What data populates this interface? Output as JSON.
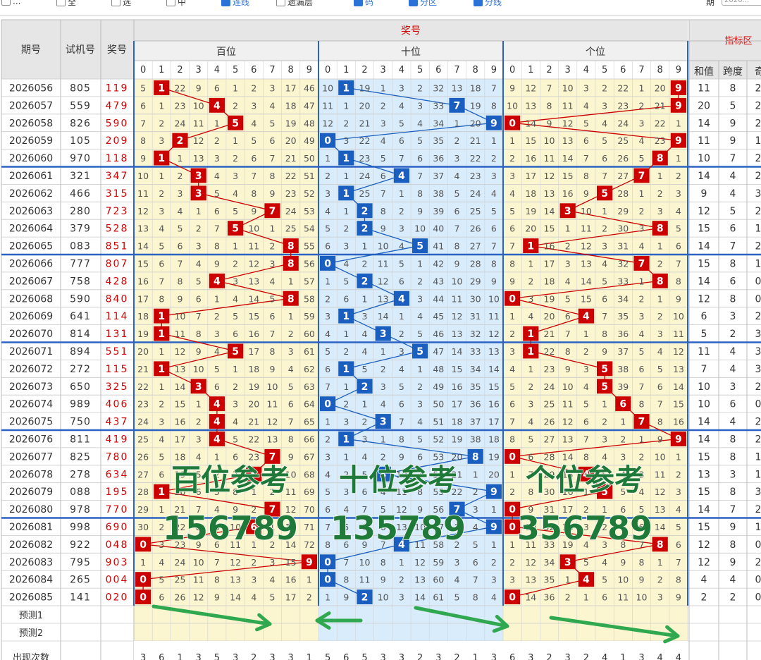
{
  "toolbar": {
    "options": [
      {
        "label": "...",
        "checked": false,
        "blue": false
      },
      {
        "label": "全",
        "checked": false,
        "blue": false
      },
      {
        "label": "选",
        "checked": false,
        "blue": false
      },
      {
        "label": "中",
        "checked": false,
        "blue": false
      },
      {
        "label": "连线",
        "checked": true,
        "blue": true
      },
      {
        "label": "遗漏层",
        "checked": false,
        "blue": false
      },
      {
        "label": "码",
        "checked": true,
        "blue": true
      },
      {
        "label": "分区",
        "checked": true,
        "blue": true
      },
      {
        "label": "分线",
        "checked": true,
        "blue": true
      }
    ],
    "period_label": "期",
    "period_value": "2026..."
  },
  "header": {
    "period": "期号",
    "trial": "试机号",
    "prize": "奖号",
    "prize_group": "奖号",
    "index_area": "指标区",
    "positions": [
      "百位",
      "十位",
      "个位"
    ],
    "digits": [
      "0",
      "1",
      "2",
      "3",
      "4",
      "5",
      "6",
      "7",
      "8",
      "9"
    ],
    "indicators": [
      "和值",
      "跨度",
      "奇"
    ]
  },
  "rows": [
    {
      "period": "2026056",
      "trial": "805",
      "prize": "119",
      "hu": [
        5,
        1,
        22,
        9,
        6,
        1,
        2,
        3,
        17,
        46
      ],
      "te": [
        10,
        1,
        19,
        1,
        3,
        2,
        32,
        13,
        18,
        7
      ],
      "ge": [
        9,
        12,
        7,
        10,
        3,
        2,
        22,
        1,
        20,
        9
      ],
      "sum": "11",
      "span": "8",
      "odd": "2"
    },
    {
      "period": "2026057",
      "trial": "559",
      "prize": "479",
      "hu": [
        6,
        1,
        23,
        10,
        4,
        2,
        3,
        4,
        18,
        47
      ],
      "te": [
        11,
        1,
        20,
        2,
        4,
        3,
        33,
        7,
        19,
        8
      ],
      "ge": [
        10,
        13,
        8,
        11,
        4,
        3,
        23,
        2,
        21,
        9
      ],
      "sum": "20",
      "span": "5",
      "odd": "2"
    },
    {
      "period": "2026058",
      "trial": "826",
      "prize": "590",
      "hu": [
        7,
        2,
        24,
        11,
        1,
        5,
        4,
        5,
        19,
        48
      ],
      "te": [
        12,
        2,
        21,
        3,
        5,
        4,
        34,
        1,
        20,
        9
      ],
      "ge": [
        0,
        14,
        9,
        12,
        5,
        4,
        24,
        3,
        22,
        1
      ],
      "sum": "14",
      "span": "9",
      "odd": "2"
    },
    {
      "period": "2026059",
      "trial": "105",
      "prize": "209",
      "hu": [
        8,
        3,
        2,
        12,
        2,
        1,
        5,
        6,
        20,
        49
      ],
      "te": [
        0,
        3,
        22,
        4,
        6,
        5,
        35,
        2,
        21,
        1
      ],
      "ge": [
        1,
        15,
        10,
        13,
        6,
        5,
        25,
        4,
        23,
        9
      ],
      "sum": "11",
      "span": "9",
      "odd": "1"
    },
    {
      "period": "2026060",
      "trial": "970",
      "prize": "118",
      "hu": [
        9,
        1,
        1,
        13,
        3,
        2,
        6,
        7,
        21,
        50
      ],
      "te": [
        1,
        1,
        23,
        5,
        7,
        6,
        36,
        3,
        22,
        2
      ],
      "ge": [
        2,
        16,
        11,
        14,
        7,
        6,
        26,
        5,
        8,
        1
      ],
      "sum": "10",
      "span": "7",
      "odd": "2"
    },
    {
      "period": "2026061",
      "trial": "321",
      "prize": "347",
      "hu": [
        10,
        1,
        2,
        3,
        4,
        3,
        7,
        8,
        22,
        51
      ],
      "te": [
        2,
        1,
        24,
        6,
        4,
        7,
        37,
        4,
        23,
        3
      ],
      "ge": [
        3,
        17,
        12,
        15,
        8,
        7,
        27,
        7,
        1,
        2
      ],
      "sum": "14",
      "span": "4",
      "odd": "2"
    },
    {
      "period": "2026062",
      "trial": "466",
      "prize": "315",
      "hu": [
        11,
        2,
        3,
        3,
        5,
        4,
        8,
        9,
        23,
        52
      ],
      "te": [
        3,
        1,
        25,
        7,
        1,
        8,
        38,
        5,
        24,
        4
      ],
      "ge": [
        4,
        18,
        13,
        16,
        9,
        5,
        28,
        1,
        2,
        3
      ],
      "sum": "9",
      "span": "4",
      "odd": "3"
    },
    {
      "period": "2026063",
      "trial": "280",
      "prize": "723",
      "hu": [
        12,
        3,
        4,
        1,
        6,
        5,
        9,
        7,
        24,
        53
      ],
      "te": [
        4,
        1,
        2,
        8,
        2,
        9,
        39,
        6,
        25,
        5
      ],
      "ge": [
        5,
        19,
        14,
        3,
        10,
        1,
        29,
        2,
        3,
        4
      ],
      "sum": "12",
      "span": "5",
      "odd": "2"
    },
    {
      "period": "2026064",
      "trial": "379",
      "prize": "528",
      "hu": [
        13,
        4,
        5,
        2,
        7,
        5,
        10,
        1,
        25,
        54
      ],
      "te": [
        5,
        2,
        2,
        9,
        3,
        10,
        40,
        7,
        26,
        6
      ],
      "ge": [
        6,
        20,
        15,
        1,
        11,
        2,
        30,
        3,
        8,
        5
      ],
      "sum": "15",
      "span": "6",
      "odd": "1"
    },
    {
      "period": "2026065",
      "trial": "083",
      "prize": "851",
      "hu": [
        14,
        5,
        6,
        3,
        8,
        1,
        11,
        2,
        8,
        55
      ],
      "te": [
        6,
        3,
        1,
        10,
        4,
        5,
        41,
        8,
        27,
        7
      ],
      "ge": [
        7,
        1,
        16,
        2,
        12,
        3,
        31,
        4,
        1,
        6
      ],
      "sum": "14",
      "span": "7",
      "odd": "2"
    },
    {
      "period": "2026066",
      "trial": "777",
      "prize": "807",
      "hu": [
        15,
        6,
        7,
        4,
        9,
        2,
        12,
        3,
        8,
        56
      ],
      "te": [
        0,
        4,
        2,
        11,
        5,
        1,
        42,
        9,
        28,
        8
      ],
      "ge": [
        8,
        1,
        17,
        3,
        13,
        4,
        32,
        7,
        2,
        7
      ],
      "sum": "15",
      "span": "8",
      "odd": "1"
    },
    {
      "period": "2026067",
      "trial": "758",
      "prize": "428",
      "hu": [
        16,
        7,
        8,
        5,
        4,
        3,
        13,
        4,
        1,
        57
      ],
      "te": [
        1,
        5,
        2,
        12,
        6,
        2,
        43,
        10,
        29,
        9
      ],
      "ge": [
        9,
        2,
        18,
        4,
        14,
        5,
        33,
        1,
        8,
        8
      ],
      "sum": "14",
      "span": "6",
      "odd": "0"
    },
    {
      "period": "2026068",
      "trial": "590",
      "prize": "840",
      "hu": [
        17,
        8,
        9,
        6,
        1,
        4,
        14,
        5,
        8,
        58
      ],
      "te": [
        2,
        6,
        1,
        13,
        4,
        3,
        44,
        11,
        30,
        10
      ],
      "ge": [
        0,
        3,
        19,
        5,
        15,
        6,
        34,
        2,
        1,
        9
      ],
      "sum": "12",
      "span": "8",
      "odd": "0"
    },
    {
      "period": "2026069",
      "trial": "641",
      "prize": "114",
      "hu": [
        18,
        1,
        10,
        7,
        2,
        5,
        15,
        6,
        1,
        59
      ],
      "te": [
        3,
        1,
        3,
        14,
        1,
        4,
        45,
        12,
        31,
        11
      ],
      "ge": [
        1,
        4,
        20,
        6,
        4,
        7,
        35,
        3,
        2,
        10
      ],
      "sum": "6",
      "span": "3",
      "odd": "2"
    },
    {
      "period": "2026070",
      "trial": "814",
      "prize": "131",
      "hu": [
        19,
        1,
        11,
        8,
        3,
        6,
        16,
        7,
        2,
        60
      ],
      "te": [
        4,
        1,
        4,
        3,
        2,
        5,
        46,
        13,
        32,
        12
      ],
      "ge": [
        2,
        1,
        21,
        7,
        1,
        8,
        36,
        4,
        3,
        11
      ],
      "sum": "5",
      "span": "2",
      "odd": "3"
    },
    {
      "period": "2026071",
      "trial": "894",
      "prize": "551",
      "hu": [
        20,
        1,
        12,
        9,
        4,
        5,
        17,
        8,
        3,
        61
      ],
      "te": [
        5,
        2,
        4,
        1,
        3,
        5,
        47,
        14,
        33,
        13
      ],
      "ge": [
        3,
        1,
        22,
        8,
        2,
        9,
        37,
        5,
        4,
        12
      ],
      "sum": "11",
      "span": "4",
      "odd": "3"
    },
    {
      "period": "2026072",
      "trial": "272",
      "prize": "115",
      "hu": [
        21,
        1,
        13,
        10,
        5,
        1,
        18,
        9,
        4,
        62
      ],
      "te": [
        6,
        1,
        5,
        2,
        4,
        1,
        48,
        15,
        34,
        14
      ],
      "ge": [
        4,
        1,
        23,
        9,
        3,
        5,
        38,
        6,
        5,
        13
      ],
      "sum": "7",
      "span": "4",
      "odd": "3"
    },
    {
      "period": "2026073",
      "trial": "650",
      "prize": "325",
      "hu": [
        22,
        1,
        14,
        3,
        6,
        2,
        19,
        10,
        5,
        63
      ],
      "te": [
        7,
        1,
        2,
        3,
        5,
        2,
        49,
        16,
        35,
        15
      ],
      "ge": [
        5,
        2,
        24,
        10,
        4,
        5,
        39,
        7,
        6,
        14
      ],
      "sum": "10",
      "span": "3",
      "odd": "2"
    },
    {
      "period": "2026074",
      "trial": "989",
      "prize": "406",
      "hu": [
        23,
        2,
        15,
        1,
        4,
        3,
        20,
        11,
        6,
        64
      ],
      "te": [
        0,
        2,
        1,
        4,
        6,
        3,
        50,
        17,
        36,
        16
      ],
      "ge": [
        6,
        3,
        25,
        11,
        5,
        1,
        6,
        8,
        7,
        15
      ],
      "sum": "10",
      "span": "6",
      "odd": "0"
    },
    {
      "period": "2026075",
      "trial": "750",
      "prize": "437",
      "hu": [
        24,
        3,
        16,
        2,
        4,
        4,
        21,
        12,
        7,
        65
      ],
      "te": [
        1,
        3,
        2,
        3,
        7,
        4,
        51,
        18,
        37,
        17
      ],
      "ge": [
        7,
        4,
        26,
        12,
        6,
        2,
        1,
        7,
        8,
        16
      ],
      "sum": "14",
      "span": "4",
      "odd": "2"
    },
    {
      "period": "2026076",
      "trial": "811",
      "prize": "419",
      "hu": [
        25,
        4,
        17,
        3,
        4,
        5,
        22,
        13,
        8,
        66
      ],
      "te": [
        2,
        1,
        3,
        1,
        8,
        5,
        52,
        19,
        38,
        18
      ],
      "ge": [
        8,
        5,
        27,
        13,
        7,
        3,
        2,
        1,
        9,
        9
      ],
      "sum": "14",
      "span": "8",
      "odd": "2"
    },
    {
      "period": "2026077",
      "trial": "825",
      "prize": "780",
      "hu": [
        26,
        5,
        18,
        4,
        1,
        6,
        23,
        7,
        9,
        67
      ],
      "te": [
        3,
        1,
        4,
        2,
        9,
        6,
        53,
        20,
        8,
        19
      ],
      "ge": [
        0,
        6,
        28,
        14,
        8,
        4,
        3,
        2,
        10,
        1
      ],
      "sum": "15",
      "span": "8",
      "odd": "1"
    },
    {
      "period": "2026078",
      "trial": "278",
      "prize": "634",
      "hu": [
        27,
        6,
        19,
        5,
        2,
        7,
        6,
        1,
        10,
        68
      ],
      "te": [
        4,
        2,
        5,
        3,
        10,
        7,
        54,
        21,
        1,
        20
      ],
      "ge": [
        1,
        7,
        29,
        15,
        4,
        5,
        4,
        3,
        11,
        2
      ],
      "sum": "13",
      "span": "3",
      "odd": "1"
    },
    {
      "period": "2026079",
      "trial": "088",
      "prize": "195",
      "hu": [
        28,
        1,
        20,
        6,
        3,
        8,
        1,
        2,
        11,
        69
      ],
      "te": [
        5,
        3,
        6,
        4,
        11,
        8,
        55,
        22,
        2,
        9
      ],
      "ge": [
        2,
        8,
        30,
        16,
        1,
        5,
        5,
        4,
        12,
        3
      ],
      "sum": "15",
      "span": "8",
      "odd": "3"
    },
    {
      "period": "2026080",
      "trial": "978",
      "prize": "770",
      "hu": [
        29,
        1,
        21,
        7,
        4,
        9,
        2,
        7,
        12,
        70
      ],
      "te": [
        6,
        4,
        7,
        5,
        12,
        9,
        56,
        7,
        3,
        1
      ],
      "ge": [
        0,
        9,
        31,
        17,
        2,
        1,
        6,
        5,
        13,
        4
      ],
      "sum": "14",
      "span": "7",
      "odd": "2"
    },
    {
      "period": "2026081",
      "trial": "998",
      "prize": "690",
      "hu": [
        30,
        2,
        22,
        8,
        5,
        10,
        6,
        1,
        13,
        71
      ],
      "te": [
        7,
        5,
        8,
        6,
        13,
        10,
        57,
        1,
        4,
        9
      ],
      "ge": [
        0,
        10,
        32,
        18,
        3,
        2,
        7,
        6,
        14,
        5
      ],
      "sum": "15",
      "span": "9",
      "odd": "1"
    },
    {
      "period": "2026082",
      "trial": "922",
      "prize": "048",
      "hu": [
        0,
        3,
        23,
        9,
        6,
        11,
        1,
        2,
        14,
        72
      ],
      "te": [
        8,
        6,
        9,
        7,
        4,
        11,
        58,
        2,
        5,
        1
      ],
      "ge": [
        1,
        11,
        33,
        19,
        4,
        3,
        8,
        7,
        8,
        6
      ],
      "sum": "12",
      "span": "8",
      "odd": "0"
    },
    {
      "period": "2026083",
      "trial": "795",
      "prize": "903",
      "hu": [
        1,
        4,
        24,
        10,
        7,
        12,
        2,
        3,
        15,
        9
      ],
      "te": [
        0,
        7,
        10,
        8,
        1,
        12,
        59,
        3,
        6,
        2
      ],
      "ge": [
        2,
        12,
        34,
        3,
        5,
        4,
        9,
        8,
        1,
        7
      ],
      "sum": "12",
      "span": "9",
      "odd": "2"
    },
    {
      "period": "2026084",
      "trial": "265",
      "prize": "004",
      "hu": [
        0,
        5,
        25,
        11,
        8,
        13,
        3,
        4,
        16,
        1
      ],
      "te": [
        0,
        8,
        11,
        9,
        2,
        13,
        60,
        4,
        7,
        3
      ],
      "ge": [
        3,
        13,
        35,
        1,
        4,
        5,
        10,
        9,
        2,
        8
      ],
      "sum": "4",
      "span": "4",
      "odd": "0"
    },
    {
      "period": "2026085",
      "trial": "141",
      "prize": "020",
      "hu": [
        0,
        6,
        26,
        12,
        9,
        14,
        4,
        5,
        17,
        2
      ],
      "te": [
        1,
        9,
        2,
        10,
        3,
        14,
        61,
        5,
        8,
        4
      ],
      "ge": [
        0,
        14,
        36,
        2,
        1,
        6,
        11,
        10,
        3,
        9
      ],
      "sum": "2",
      "span": "2",
      "odd": "0"
    }
  ],
  "footer": {
    "predict1": "预测1",
    "predict2": "预测2",
    "counts_label": "出现次数",
    "counts": [
      "3",
      "6",
      "1",
      "3",
      "5",
      "3",
      "2",
      "3",
      "3",
      "1",
      "5",
      "6",
      "5",
      "3",
      "3",
      "2",
      "3",
      "2",
      "1",
      "3",
      "6",
      "3",
      "2",
      "3",
      "2",
      "4",
      "1",
      "3",
      "4",
      "4"
    ]
  },
  "annotations": {
    "hu_ref_title": "百位参考",
    "hu_ref_digits": "156789",
    "te_ref_title": "十位参考",
    "te_ref_digits": "135789",
    "ge_ref_title": "个位参考",
    "ge_ref_digits": "356789"
  },
  "colors": {
    "hundreds_mark": "#cc0000",
    "tens_mark": "#1a5fbf",
    "units_mark": "#cc0000",
    "cell_yellow": "#fbf6cf",
    "cell_blue": "#d9ecfb",
    "header_gray": "#e6e6e6",
    "prize_red": "#d40000",
    "annotation_green": "#1f7a3a",
    "arrow_green": "#2fa84f",
    "divider_blue": "#2b62c4"
  }
}
